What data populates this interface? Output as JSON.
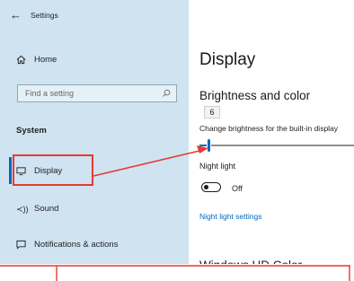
{
  "window": {
    "title": "Settings",
    "back_icon": "back-arrow-icon"
  },
  "sidebar": {
    "home_label": "Home",
    "search_placeholder": "Find a setting",
    "section_title": "System",
    "items": [
      {
        "label": "Display",
        "icon": "monitor-icon",
        "selected": true
      },
      {
        "label": "Sound",
        "icon": "speaker-icon",
        "selected": false
      },
      {
        "label": "Notifications & actions",
        "icon": "notification-icon",
        "selected": false
      }
    ]
  },
  "main": {
    "page_title": "Display",
    "brightness": {
      "heading": "Brightness and color",
      "tooltip_value": "6",
      "label": "Change brightness for the built-in display",
      "value_percent": 6
    },
    "night_light": {
      "label": "Night light",
      "state_label": "Off",
      "settings_link": "Night light settings"
    },
    "hd_heading": "Windows HD Color"
  },
  "annotation": {
    "color": "#e53935"
  },
  "colors": {
    "sidebar_bg": "#cfe3f1",
    "accent": "#0067c0"
  }
}
